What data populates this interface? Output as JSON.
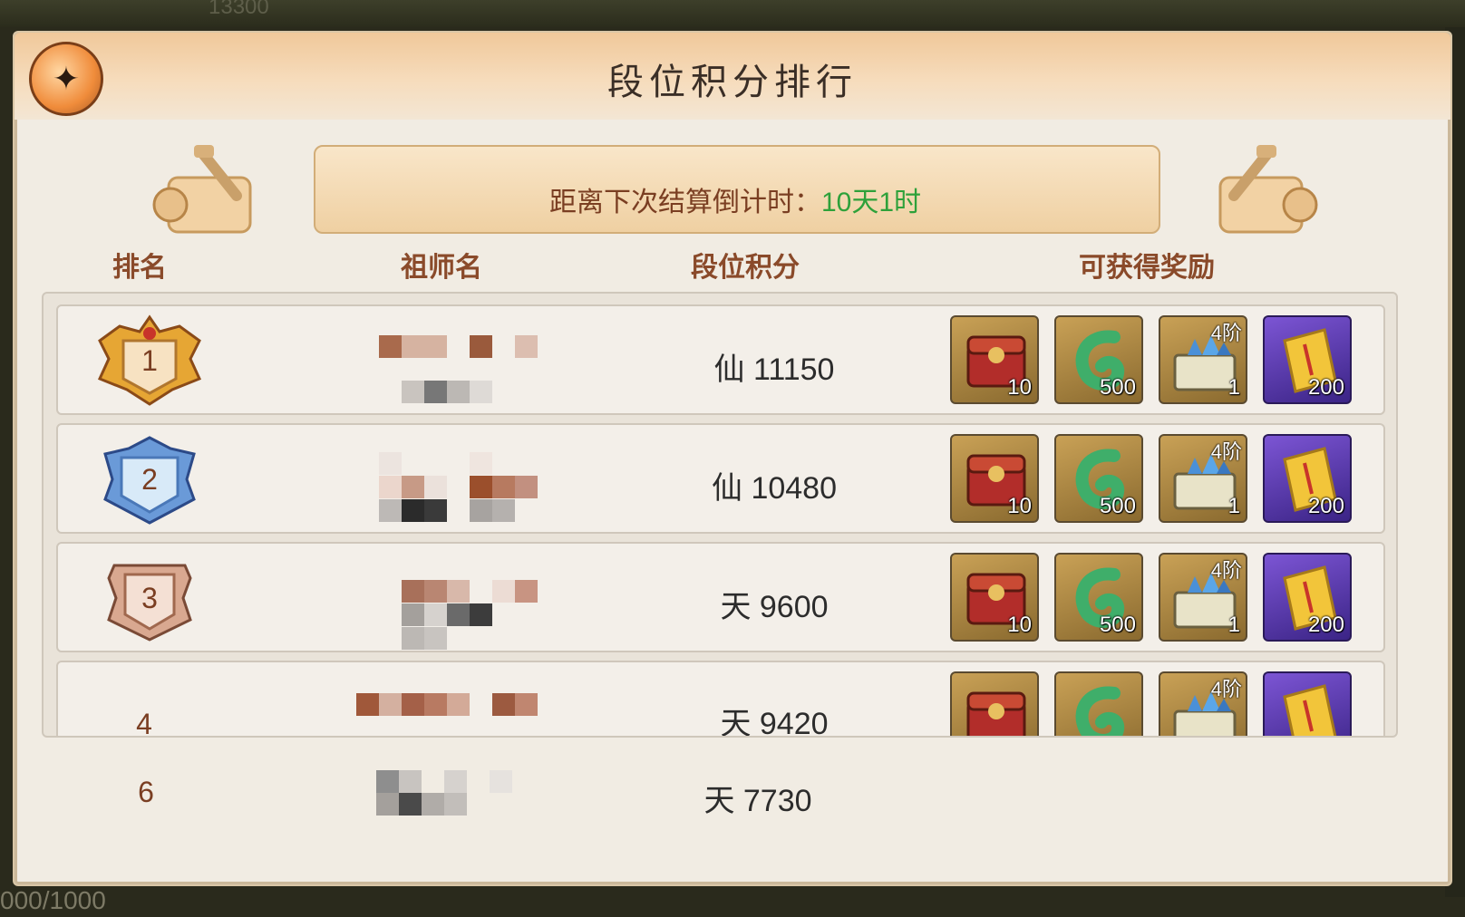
{
  "background": {
    "top_text": "13300",
    "bottom_text": "000/1000"
  },
  "panel": {
    "title": "段位积分排行",
    "countdown_label": "距离下次结算倒计时：",
    "countdown_value": "10天1时"
  },
  "columns": {
    "rank": "排名",
    "name": "祖师名",
    "score": "段位积分",
    "rewards": "可获得奖励"
  },
  "rows": [
    {
      "rank": "1",
      "score": "仙 11150"
    },
    {
      "rank": "2",
      "score": "仙 10480"
    },
    {
      "rank": "3",
      "score": "天 9600"
    },
    {
      "rank": "4",
      "score": "天 9420"
    }
  ],
  "rewards": [
    {
      "icon": "red-chest-icon",
      "count": "10",
      "tier": ""
    },
    {
      "icon": "jade-curl-icon",
      "count": "500",
      "tier": ""
    },
    {
      "icon": "crystal-chest-icon",
      "count": "1",
      "tier": "4阶"
    },
    {
      "icon": "talisman-scroll-icon",
      "count": "200",
      "tier": ""
    }
  ],
  "self": {
    "rank": "6",
    "score": "天 7730"
  },
  "colors": {
    "title_text": "#3a2e26",
    "header_text": "#8a4a2a",
    "countdown_value": "#2ea13a",
    "gold_frame": "#c9a156",
    "purple_frame": "#7c55d4"
  }
}
